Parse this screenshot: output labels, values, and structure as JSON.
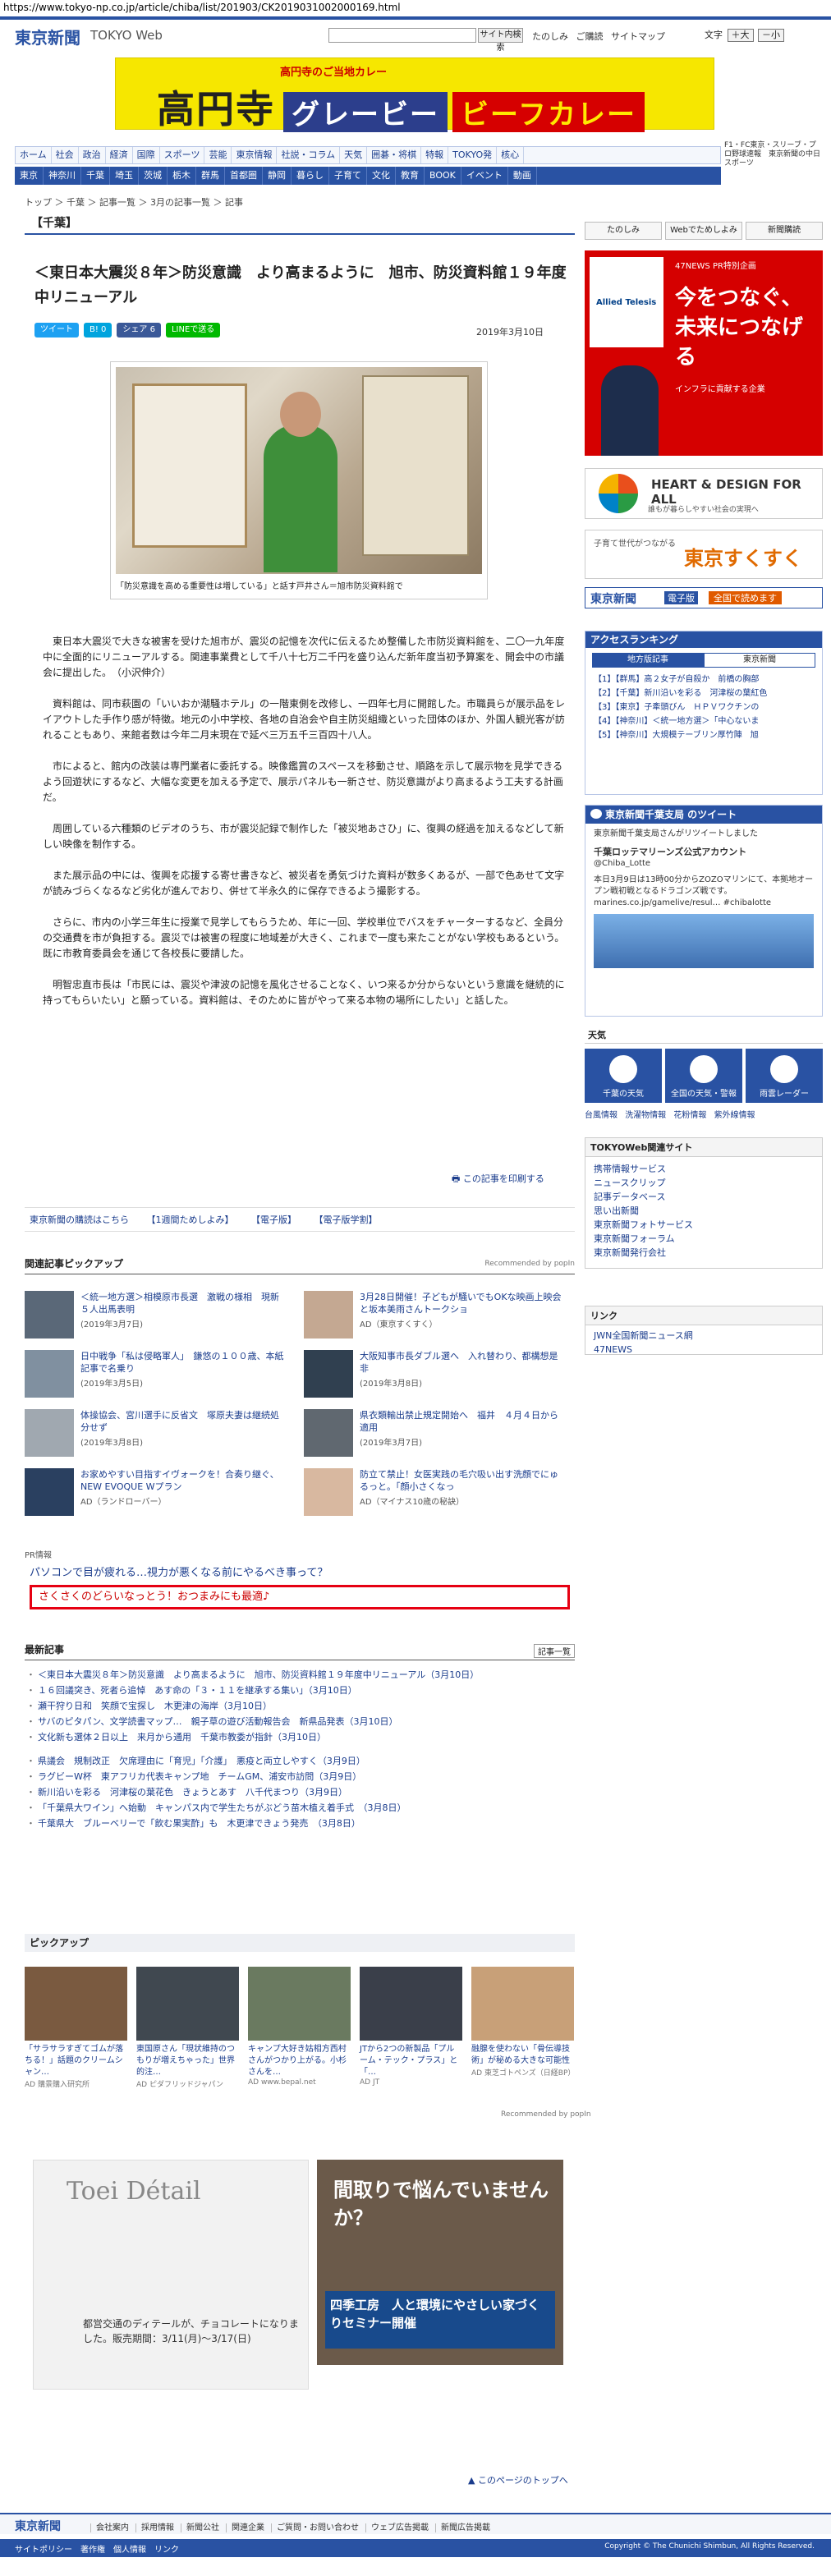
{
  "browser": {
    "url": "https://www.tokyo-np.co.jp/article/chiba/list/201903/CK2019031002000169.html"
  },
  "header": {
    "logo": "東京新聞",
    "logo_sub": "TOKYO Web",
    "search_button": "サイト内検索",
    "links": [
      "たのしみ",
      "ご購読",
      "サイトマップ"
    ],
    "font_size_label": "文字",
    "font_size_plus": "＋大",
    "font_size_minus": "－小"
  },
  "banner": {
    "sub": "高円寺のご当地カレー",
    "main": "高円寺",
    "chip1": "グレービー",
    "chip2": "ビーフカレー"
  },
  "nav_main": [
    "ホーム",
    "社会",
    "政治",
    "経済",
    "国際",
    "スポーツ",
    "芸能",
    "東京情報",
    "社説・コラム",
    "天気",
    "囲碁・将棋",
    "特報",
    "TOKYO発",
    "核心"
  ],
  "nav_right": "F1・FC東京・スリーブ・プロ野球速報　東京新聞の中日スポーツ",
  "nav_sub": [
    "東京",
    "神奈川",
    "千葉",
    "埼玉",
    "茨城",
    "栃木",
    "群馬",
    "首都圏",
    "静岡",
    "暮らし",
    "子育て",
    "文化",
    "教育",
    "BOOK",
    "イベント",
    "動画"
  ],
  "breadcrumb": "トップ ＞ 千葉 ＞ 記事一覧 ＞ 3月の記事一覧 ＞ 記事",
  "category": "【千葉】",
  "article": {
    "title": "＜東日本大震災８年＞防災意識　より高まるように　旭市、防災資料館１９年度中リニューアル",
    "date": "2019年3月10日",
    "share": {
      "tweet": "ツイート",
      "hatena": "B! 0",
      "facebook": "シェア 6",
      "line": "LINEで送る"
    },
    "caption": "「防災意識を高める重要性は増している」と話す戸井さん＝旭市防災資料館で",
    "paragraphs": [
      "東日本大震災で大きな被害を受けた旭市が、震災の記憶を次代に伝えるため整備した市防災資料館を、二〇一九年度中に全面的にリニューアルする。関連事業費として千八十七万二千円を盛り込んだ新年度当初予算案を、開会中の市議会に提出した。　（小沢伸介）",
      "資料館は、同市萩園の「いいおか潮騒ホテル」の一階東側を改修し、一四年七月に開館した。市職員らが展示品をレイアウトした手作り感が特徴。地元の小中学校、各地の自治会や自主防災組織といった団体のほか、外国人観光客が訪れることもあり、来館者数は今年二月末現在で延べ三万五千三百四十八人。",
      "市によると、館内の改装は専門業者に委託する。映像鑑賞のスペースを移動させ、順路を示して展示物を見学できるよう回遊状にするなど、大幅な変更を加える予定で、展示パネルも一新させ、防災意識がより高まるよう工夫する計画だ。",
      "周囲している六種類のビデオのうち、市が震災記録で制作した「被災地あさひ」に、復興の経過を加えるなどして新しい映像を制作する。",
      "また展示品の中には、復興を応援する寄せ書きなど、被災者を勇気づけた資料が数多くあるが、一部で色あせて文字が読みづらくなるなど劣化が進んでおり、併せて半永久的に保存できるよう撮影する。",
      "さらに、市内の小学三年生に授業で見学してもらうため、年に一回、学校単位でバスをチャーターするなど、全員分の交通費を市が負担する。震災では被害の程度に地域差が大きく、これまで一度も来たことがない学校もあるという。既に市教育委員会を通じて各校長に要請した。",
      "明智忠直市長は「市民には、震災や津波の記憶を風化させることなく、いつ来るか分からないという意識を継続的に持ってもらいたい」と願っている。資料館は、そのために皆がやって来る本物の場所にしたい」と話した。"
    ]
  },
  "print_label": "この記事を印刷する",
  "subscribe_links": [
    "東京新聞の購読はこちら",
    "【1週間ためしよみ】",
    "【電子版】",
    "【電子版学割】"
  ],
  "pickup": {
    "heading": "関連記事ピックアップ",
    "recommended": "Recommended by popIn",
    "items": [
      {
        "title": "＜統一地方選＞相模原市長選　激戦の様相　現新５人出馬表明",
        "sub": "(2019年3月7日)"
      },
      {
        "title": "3月28日開催！子どもが騒いでもOKな映画上映会と坂本美雨さんトークショ",
        "sub": "AD（東京すくすく）"
      },
      {
        "title": "日中戦争「私は侵略軍人」　鎌悠の１００歳、本紙記事で名乗り",
        "sub": "(2019年3月5日)"
      },
      {
        "title": "大阪知事市長ダブル選へ　入れ替わり、都構想是非",
        "sub": "(2019年3月8日)"
      },
      {
        "title": "体操協会、宮川選手に反省文　塚原夫妻は継続処分せず",
        "sub": "(2019年3月8日)"
      },
      {
        "title": "県衣類輸出禁止規定開始へ　福井　４月４日から適用",
        "sub": "(2019年3月7日)"
      },
      {
        "title": "お家めやすい目指すイヴォークを！合奏り継ぐ、NEW EVOQUE Wプラン",
        "sub": "AD（ランドローバー）"
      },
      {
        "title": "防立て禁止！女医実践の毛穴吸い出す洗顔でにゅるっと。「顔小さくなっ",
        "sub": "AD（マイナス10歳の秘訣）"
      }
    ]
  },
  "pr": {
    "label": "PR情報",
    "item1": "パソコンで目が疲れる…視力が悪くなる前にやるべき事って？",
    "item2": "さくさくのどらいなっとう！おつまみにも最適♪"
  },
  "latest": {
    "heading": "最新記事",
    "more": "記事一覧",
    "group1": [
      "＜東日本大震災８年＞防災意識　より高まるように　旭市、防災資料館１９年度中リニューアル（3月10日）",
      "１６回議突き、死者ら追悼　あす命の「３・１１を継承する集い」（3月10日）",
      "瀬干狩り日和　笑顔で宝探し　木更津の海岸（3月10日）",
      "サバのピタパン、文学読書マップ…　親子草の遊び活動報告会　新県品発表（3月10日）",
      "文化新も選体２日以上　来月から通用　千葉市教委が指針（3月10日）"
    ],
    "group2": [
      "県議会　規制改正　欠席理由に「育児」「介護」　悪疫と両立しやすく（3月9日）",
      "ラグビーW杯　東アフリカ代表キャンプ地　チームGM、浦安市訪問（3月9日）",
      "新川沿いを彩る　河津桜の葉花色　きょうとあす　八千代まつり（3月9日）",
      "「千葉県大ワイン」へ始動　キャンパス内で学生たちがぶどう苗木植え着手式　（3月8日）",
      "千葉県大　ブルーベリーで「飲む果実酢」も　木更津できょう発売　（3月8日）"
    ]
  },
  "pickup2": {
    "heading": "ピックアップ",
    "recommended": "Recommended by popIn",
    "items": [
      {
        "title": "「サラサラすぎてゴムが落ちる！」話題のクリームシャン…",
        "sub": "AD 購景購入研究所"
      },
      {
        "title": "東国原さん「現状維持のつもりが増えちゃった」世界的注…",
        "sub": "AD ピダフリッドジャパン"
      },
      {
        "title": "キャンプ大好き姑相方西村さんがつかり上がる。小杉さんを…",
        "sub": "AD www.bepal.net"
      },
      {
        "title": "JTから2つの新製品「プルーム・テック・プラス」と「…",
        "sub": "AD JT"
      },
      {
        "title": "融腺を使わない「骨伝導技術」が秘める大きな可能性",
        "sub": "AD 東芝ゴトペンズ（日経BP）"
      }
    ]
  },
  "ads": {
    "toei_logo": "Toei Détail",
    "toei_copy": "都営交通のディテールが、チョコレートになりました。販売期間：3/11(月)～3/17(日)",
    "house_copy": "間取りで悩んでいませんか？",
    "house_box": "四季工房　人と環境にやさしい家づくりセミナー開催"
  },
  "page_top": "このページのトップへ",
  "footer": {
    "logo": "東京新聞",
    "links": [
      "会社案内",
      "採用情報",
      "新聞公社",
      "関連企業",
      "ご質問・お問い合わせ",
      "ウェブ広告掲載",
      "新聞広告掲載"
    ],
    "links2": [
      "サイトポリシー",
      "著作権",
      "個人情報",
      "リンク"
    ],
    "copyright": "Copyright © The Chunichi Shimbun, All Rights Reserved."
  },
  "sidebar": {
    "tabs": [
      "たのしみ",
      "Webでためしよみ",
      "新聞購読"
    ],
    "ad47": {
      "logo": "Allied Telesis",
      "head": "47NEWS PR特別企画",
      "big": "今をつなぐ、未来につなげる",
      "small": "インフラに貢献する企業"
    },
    "heart": {
      "title": "HEART & DESIGN FOR ALL",
      "sub": "誰もが暮らしやすい社会の実現へ"
    },
    "sukusuku": {
      "copy": "子育て世代がつながる",
      "brand": "東京すくすく"
    },
    "denshi": {
      "brand": "東京新聞",
      "label": "電子版",
      "cta": "全国で読めます"
    },
    "ranking": {
      "heading": "アクセスランキング",
      "tab_on": "地方版記事",
      "tab_off": "東京新聞",
      "items": [
        "【1】【群馬】高２女子が自殺か　前橋の胸部",
        "【2】【千葉】新川沿いを彩る　河津桜の葉紅色",
        "【3】【東京】子牽頭びん　ＨＰＶワクチンの",
        "【4】【神奈川】＜統一地方選＞「中心ないま",
        "【5】【神奈川】大規模テーブリン厚竹陣　旭"
      ]
    },
    "twitter": {
      "heading": "東京新聞千葉支局 のツイート",
      "retweet": "東京新聞千葉支局さんがリツイートしました",
      "account": "千葉ロッテマリーンズ公式アカウント",
      "handle": "@Chiba_Lotte",
      "text": "本日3月9日は13時00分からZOZOマリンにて、本拠地オープン戦初戦となるドラゴンズ戦です。marines.co.jp/gamelive/resul… #chibalotte"
    },
    "weather": {
      "heading": "天気",
      "buttons": [
        "千葉の天気",
        "全国の天気・警報",
        "雨雲レーダー"
      ],
      "links": [
        "台風情報",
        "洗濯物情報",
        "花粉情報",
        "紫外線情報"
      ]
    },
    "related_sites": {
      "heading": "TOKYOWeb関連サイト",
      "items": [
        "携帯情報サービス",
        "ニュースクリップ",
        "記事データベース",
        "思い出新聞",
        "東京新聞フォトサービス",
        "東京新聞フォーラム",
        "東京新聞発行会社"
      ]
    },
    "links": {
      "heading": "リンク",
      "items": [
        "JWN全国新聞ニュース網",
        "47NEWS"
      ]
    }
  }
}
